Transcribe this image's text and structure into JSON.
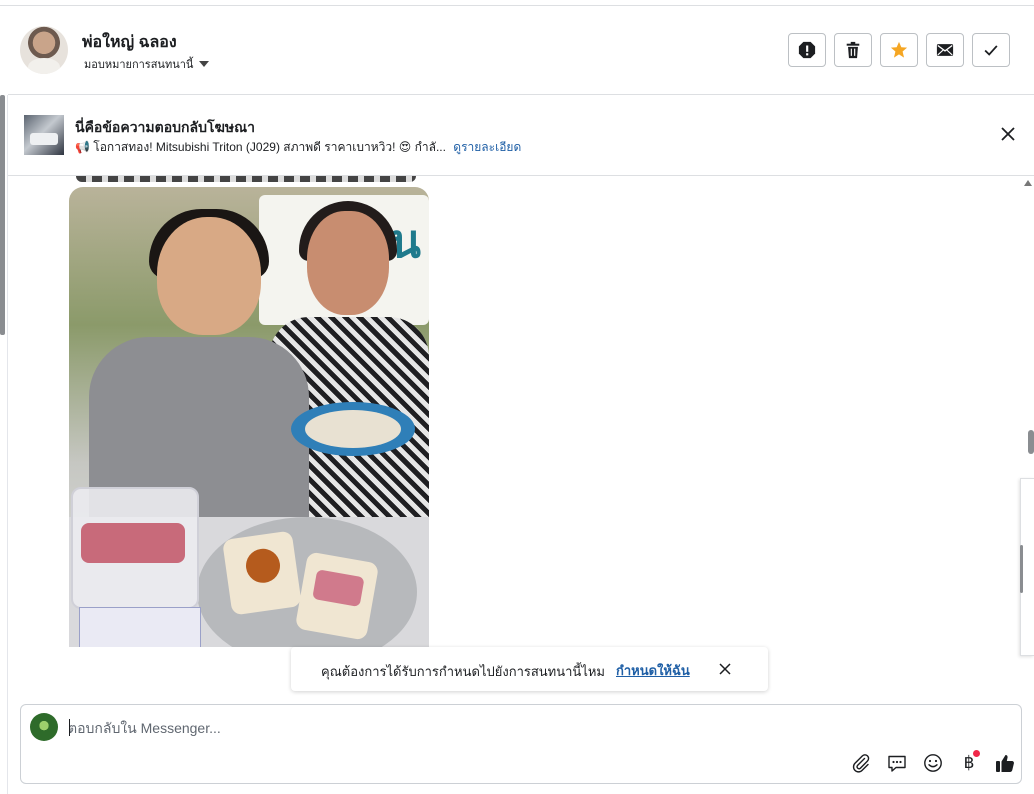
{
  "header": {
    "contact_name": "พ่อใหญ่ ฉลอง",
    "assign_label": "มอบหมายการสนทนานี้",
    "actions": [
      {
        "name": "report-spam",
        "icon": "exclamation-icon"
      },
      {
        "name": "delete",
        "icon": "trash-icon"
      },
      {
        "name": "star",
        "icon": "star-icon",
        "color": "#f5a623"
      },
      {
        "name": "mark-unread",
        "icon": "envelope-icon"
      },
      {
        "name": "mark-done",
        "icon": "checkmark-icon"
      }
    ]
  },
  "ad_banner": {
    "title": "นี่คือข้อความตอบกลับโฆษณา",
    "subtitle": "📢 โอกาสทอง! Mitsubishi Triton (J029) สภาพดี ราคาเบาหวิว! 😍 กำลั...",
    "details_link": "ดูรายละเอียด"
  },
  "notice": {
    "text": "คุณต้องการได้รับการกำหนดไปยังการสนทนานี้ไหม",
    "link": "กำหนดให้ฉัน"
  },
  "composer": {
    "placeholder": "ตอบกลับใน Messenger...",
    "baht_symbol": "฿",
    "tools": [
      "paperclip-icon",
      "saved-reply-icon",
      "emoji-icon",
      "baht-icon",
      "thumbs-up-icon"
    ]
  },
  "colors": {
    "link": "#1f5fa6",
    "star": "#f5a623",
    "notification_dot": "#f02849",
    "border": "#dddfe2"
  }
}
